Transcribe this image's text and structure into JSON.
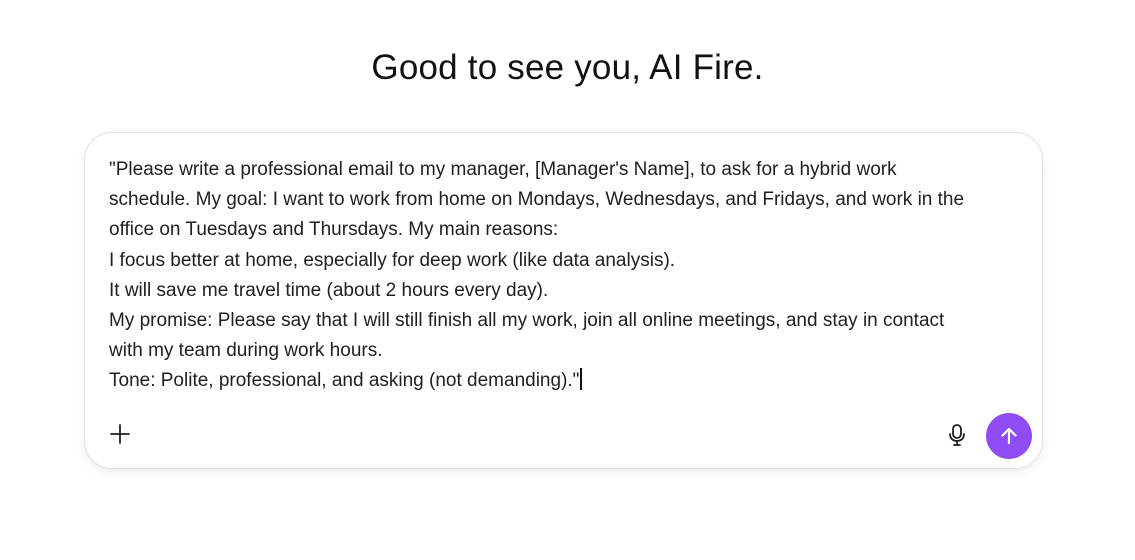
{
  "greeting": "Good to see you, AI Fire.",
  "composer": {
    "prompt_lines": [
      "\"Please write a professional email to my manager, [Manager's Name], to ask for a hybrid work",
      "schedule. My goal: I want to work from home on Mondays, Wednesdays, and Fridays, and work in the",
      "office on Tuesdays and Thursdays. My main reasons:",
      "I focus better at home, especially for deep work (like data analysis).",
      "It will save me travel time (about 2 hours every day).",
      "My promise: Please say that I will still finish all my work, join all online meetings, and stay in contact",
      "with my team during work hours.",
      "Tone: Polite, professional, and asking (not demanding).\""
    ],
    "icons": {
      "add": "plus-icon",
      "mic": "microphone-icon",
      "send": "arrow-up-icon"
    }
  },
  "colors": {
    "accent": "#8f4cf5",
    "border": "#e3e3e3",
    "text": "#1f1f1f"
  }
}
